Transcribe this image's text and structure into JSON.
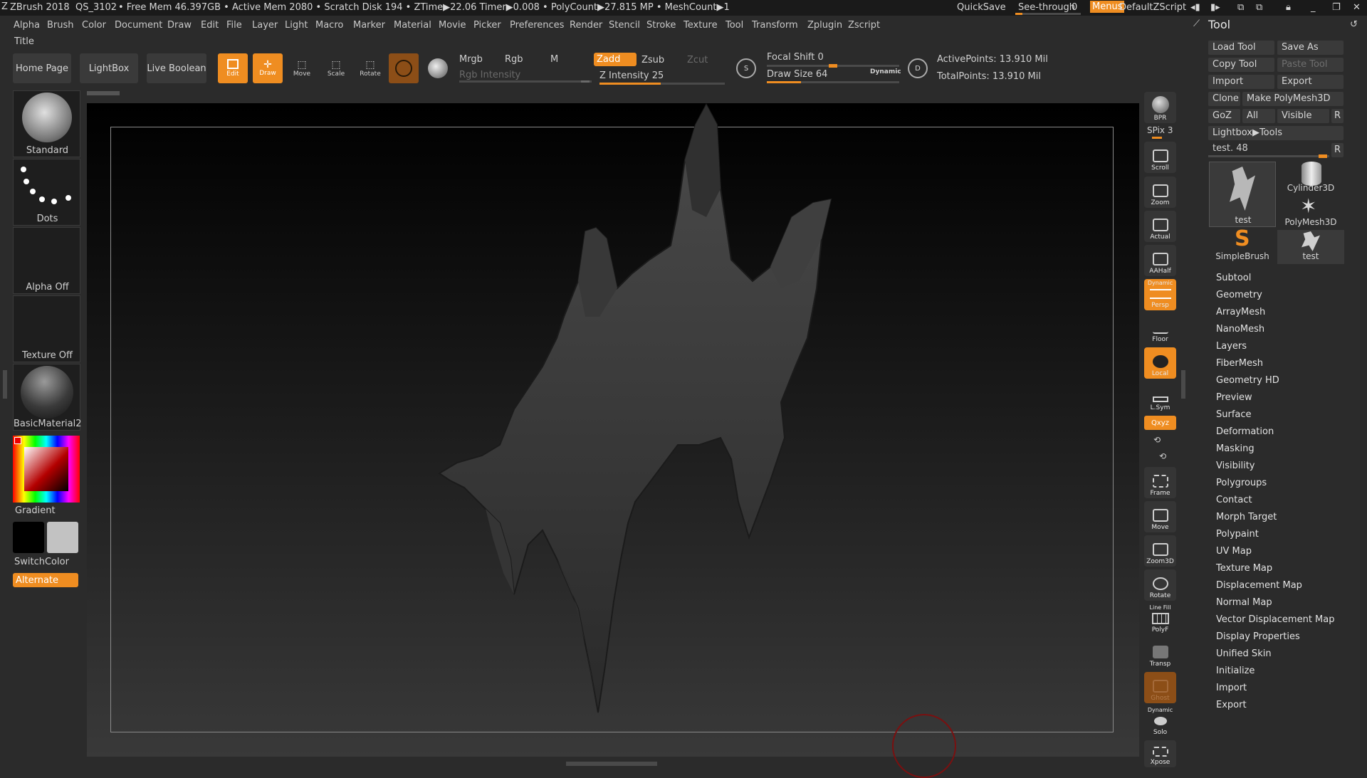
{
  "titlebar": {
    "app": "ZBrush 2018",
    "doc": "QS_3102",
    "stats": "• Free Mem 46.397GB • Active Mem 2080 • Scratch Disk 194 • ZTime▶22.06 Timer▶0.008 • PolyCount▶27.815 MP • MeshCount▶1",
    "quicksave": "QuickSave",
    "see_through_label": "See-through",
    "see_through_value": "0",
    "menus": "Menus",
    "script": "DefaultZScript"
  },
  "menubar": [
    "Alpha",
    "Brush",
    "Color",
    "Document",
    "Draw",
    "Edit",
    "File",
    "Layer",
    "Light",
    "Macro",
    "Marker",
    "Material",
    "Movie",
    "Picker",
    "Preferences",
    "Render",
    "Stencil",
    "Stroke",
    "Texture",
    "Tool",
    "Transform",
    "Zplugin",
    "Zscript"
  ],
  "subbar": {
    "title": "Title"
  },
  "toolbar": {
    "home": "Home Page",
    "lightbox": "LightBox",
    "live_boolean": "Live Boolean",
    "edit": "Edit",
    "draw": "Draw",
    "move": "Move",
    "scale": "Scale",
    "rotate": "Rotate",
    "mrgb": "Mrgb",
    "rgb": "Rgb",
    "m": "M",
    "zadd": "Zadd",
    "zsub": "Zsub",
    "zcut": "Zcut",
    "rgb_intensity": "Rgb Intensity",
    "z_intensity": "Z Intensity 25",
    "z_intensity_value": 25,
    "focal_shift": "Focal Shift 0",
    "focal_shift_value": 0,
    "draw_size": "Draw Size 64",
    "draw_size_value": 64,
    "dynamic": "Dynamic",
    "active_points": "ActivePoints: 13.910 Mil",
    "total_points": "TotalPoints: 13.910 Mil",
    "s_label": "S",
    "d_label": "D"
  },
  "leftshelf": {
    "brush": "Standard",
    "stroke": "Dots",
    "alpha": "Alpha Off",
    "texture": "Texture Off",
    "material": "BasicMaterial2",
    "gradient": "Gradient",
    "switchcolor": "SwitchColor",
    "alternate": "Alternate"
  },
  "rightshelf": {
    "bpr": "BPR",
    "spix": "SPix 3",
    "scroll": "Scroll",
    "zoom": "Zoom",
    "actual": "Actual",
    "aahalf": "AAHalf",
    "dynamic_persp_top": "Dynamic",
    "persp": "Persp",
    "floor": "Floor",
    "local": "Local",
    "lsym": "L.Sym",
    "xyz": "Qxyz",
    "frame": "Frame",
    "move": "Move",
    "zoom3d": "Zoom3D",
    "rotate": "Rotate",
    "linefill_top": "Line Fill",
    "polyf": "PolyF",
    "transp": "Transp",
    "ghost": "Ghost",
    "dynamic_solo_top": "Dynamic",
    "solo": "Solo",
    "xpose": "Xpose"
  },
  "toolpanel": {
    "title": "Tool",
    "load_tool": "Load Tool",
    "save_as": "Save As",
    "copy_tool": "Copy Tool",
    "paste_tool": "Paste Tool",
    "import": "Import",
    "export": "Export",
    "clone": "Clone",
    "make_polymesh": "Make PolyMesh3D",
    "goz": "GoZ",
    "all": "All",
    "visible": "Visible",
    "r": "R",
    "lightbox_tools": "Lightbox▶Tools",
    "current_tool": "test. 48",
    "current_tool_value": 48,
    "thumbs": [
      "test",
      "Cylinder3D",
      "PolyMesh3D",
      "SimpleBrush",
      "test"
    ],
    "subpalettes": [
      "Subtool",
      "Geometry",
      "ArrayMesh",
      "NanoMesh",
      "Layers",
      "FiberMesh",
      "Geometry HD",
      "Preview",
      "Surface",
      "Deformation",
      "Masking",
      "Visibility",
      "Polygroups",
      "Contact",
      "Morph Target",
      "Polypaint",
      "UV Map",
      "Texture Map",
      "Displacement Map",
      "Normal Map",
      "Vector Displacement Map",
      "Display Properties",
      "Unified Skin",
      "Initialize",
      "Import",
      "Export"
    ]
  },
  "colors": {
    "accent": "#ef8d21",
    "bg": "#2b2b2b",
    "panel": "#3a3a3a"
  }
}
